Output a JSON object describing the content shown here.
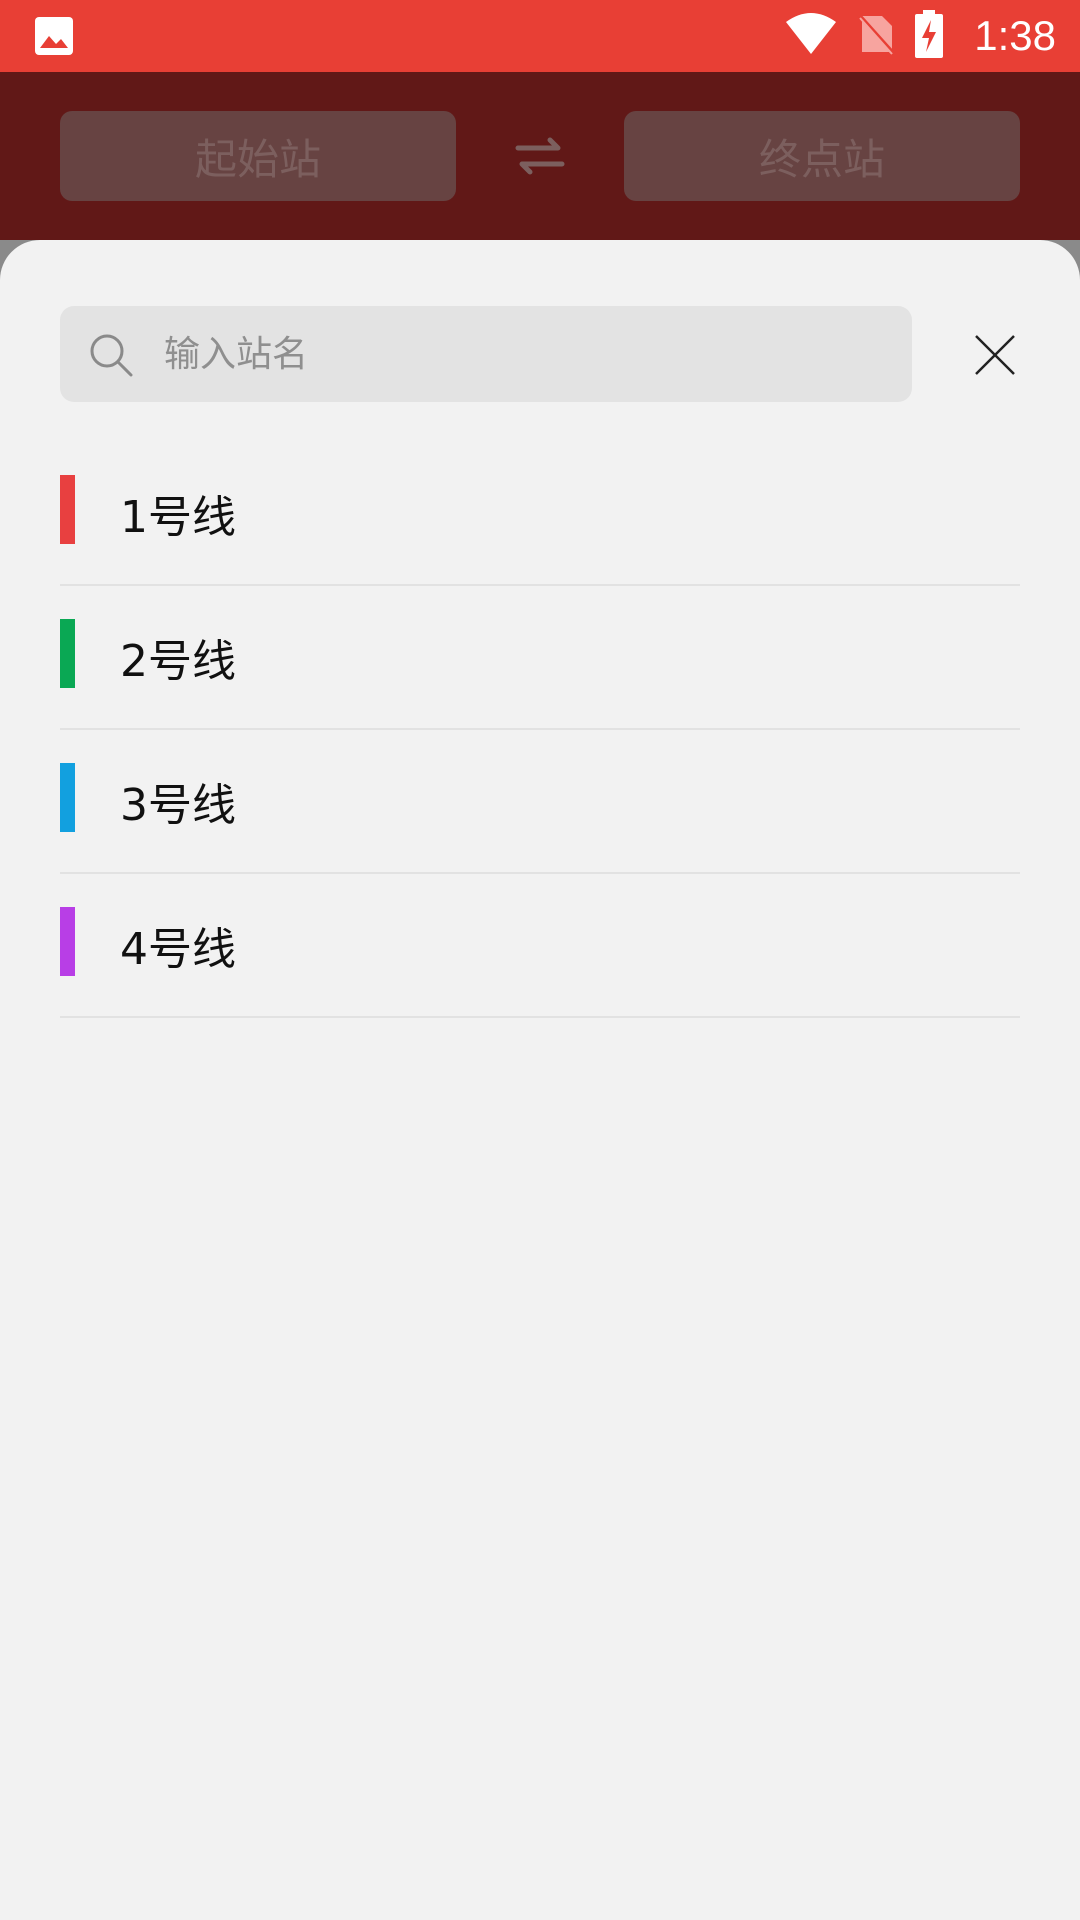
{
  "status_bar": {
    "time": "1:38",
    "icons": [
      "image-icon",
      "wifi-icon",
      "no-sim-icon",
      "battery-charging-icon"
    ],
    "color": "#e83f35"
  },
  "header": {
    "start_station_label": "起始站",
    "end_station_label": "终点站",
    "swap_icon": "swap-arrows-icon"
  },
  "search": {
    "placeholder": "输入站名",
    "value": ""
  },
  "lines": [
    {
      "label": "1号线",
      "color": "#e84040"
    },
    {
      "label": "2号线",
      "color": "#0aa854"
    },
    {
      "label": "3号线",
      "color": "#12a0df"
    },
    {
      "label": "4号线",
      "color": "#b83ee6"
    }
  ]
}
